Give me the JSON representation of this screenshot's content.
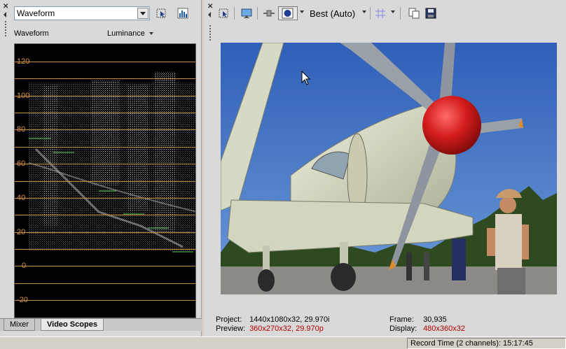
{
  "left": {
    "scope_select_value": "Waveform",
    "scope_title": "Waveform",
    "channel_dropdown": "Luminance",
    "y_axis_labels": [
      "120",
      "100",
      "80",
      "60",
      "40",
      "20",
      "0",
      "-20"
    ],
    "tabs": [
      {
        "label": "Mixer",
        "active": false
      },
      {
        "label": "Video Scopes",
        "active": true
      }
    ]
  },
  "right": {
    "toolbar": {
      "quality_label": "Best (Auto)"
    },
    "info": {
      "project_label": "Project:",
      "project_value": "1440x1080x32, 29.970i",
      "preview_label": "Preview:",
      "preview_value": "360x270x32, 29.970p",
      "frame_label": "Frame:",
      "frame_value": "30,935",
      "display_label": "Display:",
      "display_value": "480x360x32"
    }
  },
  "status": {
    "record_time": "Record Time (2 channels): 15:17:45"
  },
  "colors": {
    "scope_bg": "#000000",
    "grid_line": "#c68a3c",
    "grid_label": "#d9934a",
    "warning_red": "#b00000",
    "sky": "#3d6fc4",
    "plane_body": "#d8dcc4",
    "spinner": "#d41c1c"
  },
  "icons": [
    "close-icon",
    "collapse-arrow-icon",
    "select-cursor-icon",
    "histogram-icon",
    "monitor-icon",
    "split-view-icon",
    "overlay-icon",
    "grid-icon",
    "copy-frame-icon",
    "save-frame-icon",
    "mouse-cursor-icon"
  ]
}
